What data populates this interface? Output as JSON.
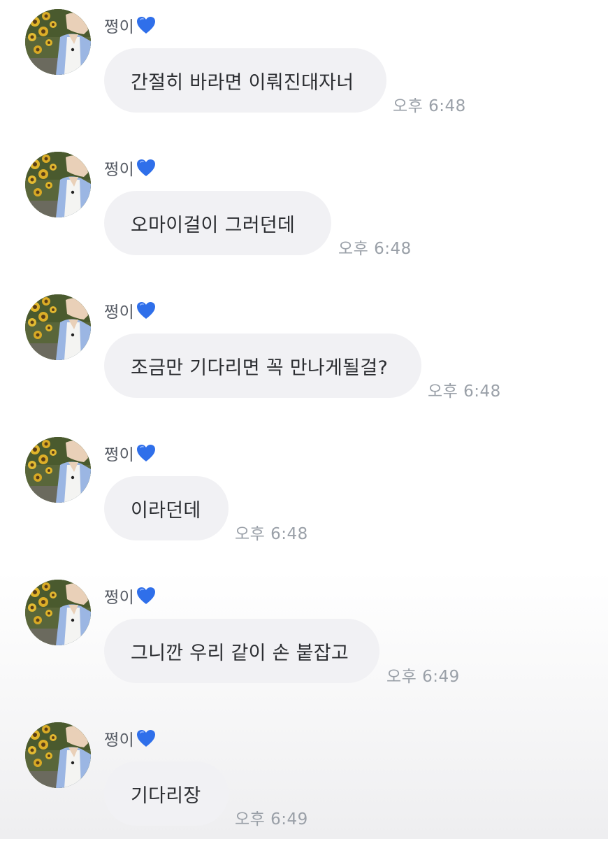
{
  "messages": [
    {
      "sender": "쩡이",
      "heart_icon": "blue-heart-icon",
      "text": "간절히 바라면 이뤄진대자너",
      "time": "오후 6:48"
    },
    {
      "sender": "쩡이",
      "heart_icon": "blue-heart-icon",
      "text": "오마이걸이 그러던데",
      "time": "오후 6:48"
    },
    {
      "sender": "쩡이",
      "heart_icon": "blue-heart-icon",
      "text": "조금만 기다리면 꼭 만나게될걸?",
      "time": "오후 6:48"
    },
    {
      "sender": "쩡이",
      "heart_icon": "blue-heart-icon",
      "text": "이라던데",
      "time": "오후 6:48"
    },
    {
      "sender": "쩡이",
      "heart_icon": "blue-heart-icon",
      "text": "그니깐 우리 같이 손 붙잡고",
      "time": "오후 6:49"
    },
    {
      "sender": "쩡이",
      "heart_icon": "blue-heart-icon",
      "text": "기다리장",
      "time": "오후 6:49"
    }
  ],
  "colors": {
    "bubble": "#f1f1f4",
    "message_text": "#2b2d31",
    "sender_name": "#555a63",
    "timestamp": "#9aa0a8",
    "heart": "#2f6fea"
  }
}
